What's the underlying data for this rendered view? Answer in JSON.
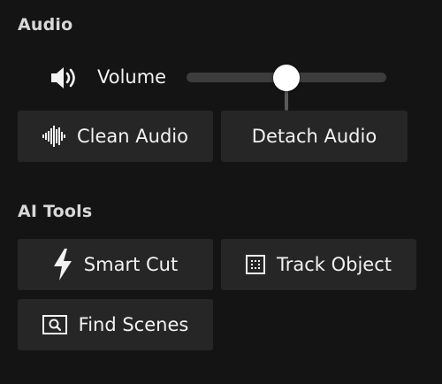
{
  "audio": {
    "section_title": "Audio",
    "volume": {
      "icon": "speaker-icon",
      "label": "Volume",
      "value_fraction": 0.5
    },
    "buttons": {
      "clean_audio": {
        "label": "Clean Audio",
        "icon": "waveform-icon"
      },
      "detach_audio": {
        "label": "Detach Audio"
      }
    }
  },
  "ai_tools": {
    "section_title": "AI Tools",
    "buttons": {
      "smart_cut": {
        "label": "Smart Cut",
        "icon": "lightning-icon"
      },
      "track_object": {
        "label": "Track Object",
        "icon": "target-frame-icon"
      },
      "find_scenes": {
        "label": "Find Scenes",
        "icon": "search-frame-icon"
      }
    }
  },
  "colors": {
    "background": "#141414",
    "button_bg": "#262626",
    "text": "#f2f2f2",
    "slider_track": "#3d3d3d",
    "slider_thumb": "#ffffff"
  }
}
